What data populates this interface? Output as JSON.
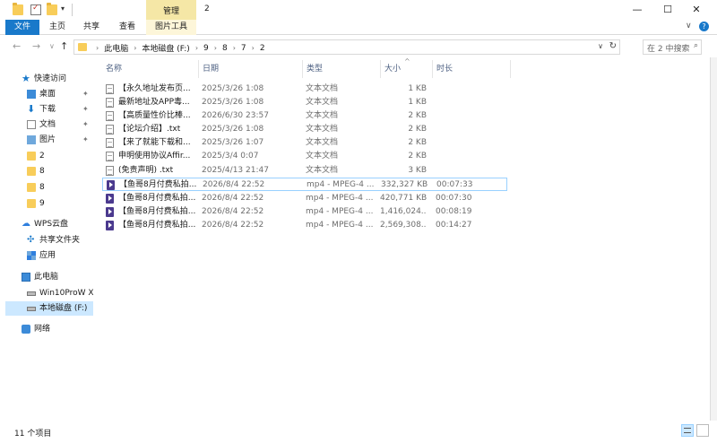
{
  "window": {
    "title": "2",
    "context_group": "管理",
    "minimize": "—",
    "maximize": "☐",
    "close": "✕"
  },
  "ribbon": {
    "tabs": [
      "文件",
      "主页",
      "共享",
      "查看",
      "图片工具"
    ],
    "collapse_chevron": "∨",
    "help": "?"
  },
  "address": {
    "crumbs": [
      "此电脑",
      "本地磁盘 (F:)",
      "9",
      "8",
      "7",
      "2"
    ],
    "search_placeholder": "在 2 中搜索"
  },
  "nav_pane": [
    {
      "label": "快速访问",
      "icon": "star-icon",
      "level": 0
    },
    {
      "label": "桌面",
      "icon": "desktop-icon",
      "level": 1,
      "pinned": true
    },
    {
      "label": "下载",
      "icon": "download-icon",
      "level": 1,
      "pinned": true
    },
    {
      "label": "文档",
      "icon": "document-icon",
      "level": 1,
      "pinned": true
    },
    {
      "label": "图片",
      "icon": "pictures-icon",
      "level": 1,
      "pinned": true
    },
    {
      "label": "2",
      "icon": "folder-icon",
      "level": 1
    },
    {
      "label": "8",
      "icon": "folder-icon",
      "level": 1
    },
    {
      "label": "8",
      "icon": "folder-icon",
      "level": 1
    },
    {
      "label": "9",
      "icon": "folder-icon",
      "level": 1
    },
    {
      "label": "WPS云盘",
      "icon": "cloud-icon",
      "level": 0
    },
    {
      "label": "共享文件夹",
      "icon": "share-icon",
      "level": 1
    },
    {
      "label": "应用",
      "icon": "apps-icon",
      "level": 1
    },
    {
      "label": "此电脑",
      "icon": "pc-icon",
      "level": 0
    },
    {
      "label": "Win10ProW X",
      "icon": "drive-icon",
      "level": 1
    },
    {
      "label": "本地磁盘 (F:)",
      "icon": "drive-icon",
      "level": 1,
      "selected": true
    },
    {
      "label": "网络",
      "icon": "network-icon",
      "level": 0
    }
  ],
  "columns": {
    "name": "名称",
    "date": "日期",
    "type": "类型",
    "size": "大小",
    "length": "时长"
  },
  "files": [
    {
      "name": "【永久地址发布页...",
      "date": "2025/3/26 1:08",
      "type": "文本文档",
      "size": "1 KB",
      "length": "",
      "icon": "text-file-icon"
    },
    {
      "name": "最新地址及APP毒...",
      "date": "2025/3/26 1:08",
      "type": "文本文档",
      "size": "1 KB",
      "length": "",
      "icon": "text-file-icon"
    },
    {
      "name": "【高质量性价比棒...",
      "date": "2026/6/30 23:57",
      "type": "文本文档",
      "size": "2 KB",
      "length": "",
      "icon": "text-file-icon"
    },
    {
      "name": "【论坛介绍】.txt",
      "date": "2025/3/26 1:08",
      "type": "文本文档",
      "size": "2 KB",
      "length": "",
      "icon": "text-file-icon"
    },
    {
      "name": "【来了就能下载和...",
      "date": "2025/3/26 1:07",
      "type": "文本文档",
      "size": "2 KB",
      "length": "",
      "icon": "text-file-icon"
    },
    {
      "name": "申明使用协议Affir...",
      "date": "2025/3/4 0:07",
      "type": "文本文档",
      "size": "2 KB",
      "length": "",
      "icon": "text-file-icon"
    },
    {
      "name": "(免责声明) .txt",
      "date": "2025/4/13 21:47",
      "type": "文本文档",
      "size": "3 KB",
      "length": "",
      "icon": "text-file-icon"
    },
    {
      "name": "【鱼哥8月付费私拍...",
      "date": "2026/8/4 22:52",
      "type": "mp4 - MPEG-4 ...",
      "size": "332,327 KB",
      "length": "00:07:33",
      "icon": "video-file-icon",
      "highlighted": true
    },
    {
      "name": "【鱼哥8月付费私拍...",
      "date": "2026/8/4 22:52",
      "type": "mp4 - MPEG-4 ...",
      "size": "420,771 KB",
      "length": "00:07:30",
      "icon": "video-file-icon"
    },
    {
      "name": "【鱼哥8月付费私拍...",
      "date": "2026/8/4 22:52",
      "type": "mp4 - MPEG-4 ...",
      "size": "1,416,024...",
      "length": "00:08:19",
      "icon": "video-file-icon"
    },
    {
      "name": "【鱼哥8月付费私拍...",
      "date": "2026/8/4 22:52",
      "type": "mp4 - MPEG-4 ...",
      "size": "2,569,308...",
      "length": "00:14:27",
      "icon": "video-file-icon"
    }
  ],
  "status": {
    "item_count": "11 个项目"
  }
}
